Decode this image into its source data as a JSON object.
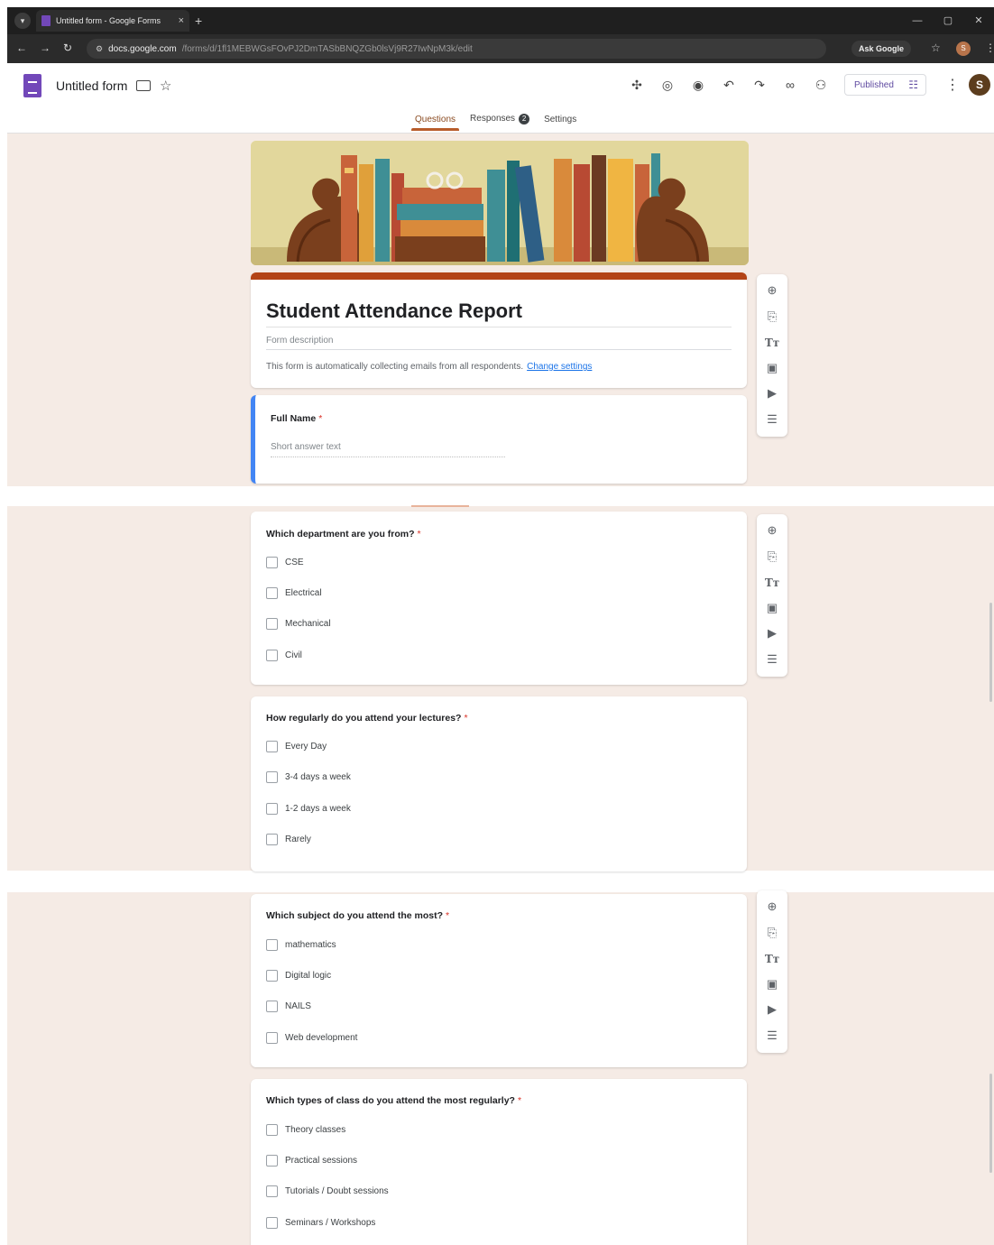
{
  "browser": {
    "tab_title": "Untitled form - Google Forms",
    "tab_close": "×",
    "new_tab": "+",
    "url_host": "docs.google.com",
    "url_path": "/forms/d/1fl1MEBWGsFOvPJ2DmTASbBNQZGb0lsVj9R27IwNpM3k/edit",
    "ask_google": "Ask Google",
    "profile_initial": "S",
    "window_buttons": [
      "—",
      "▢",
      "✕"
    ]
  },
  "header": {
    "doc_title": "Untitled form",
    "published_label": "Published",
    "avatar_initial": "S",
    "tabs": [
      {
        "label": "Questions"
      },
      {
        "label": "Responses",
        "badge": "2"
      },
      {
        "label": "Settings"
      }
    ]
  },
  "form": {
    "title": "Student Attendance Report",
    "description_placeholder": "Form description",
    "email_note": "This form is automatically collecting emails from all respondents.",
    "change_settings": "Change settings"
  },
  "required_mark": "*",
  "questions": [
    {
      "title": "Full Name",
      "placeholder": "Short answer text"
    },
    {
      "title": "Which department are you from?",
      "options": [
        "CSE",
        "Electrical",
        "Mechanical",
        "Civil"
      ]
    },
    {
      "title": "How regularly do you attend your lectures?",
      "options": [
        "Every Day",
        "3-4 days a week",
        "1-2 days a week",
        "Rarely"
      ]
    },
    {
      "title": "Which subject do you attend the most?",
      "options": [
        "mathematics",
        "Digital logic",
        "NAILS",
        "Web development"
      ]
    },
    {
      "title": "Which types of class do you attend the most regularly?",
      "options": [
        "Theory classes",
        "Practical sessions",
        "Tutorials / Doubt sessions",
        "Seminars / Workshops"
      ]
    }
  ],
  "toolbar_icons": [
    "add-question-icon",
    "import-questions-icon",
    "add-title-icon",
    "add-image-icon",
    "add-video-icon",
    "add-section-icon"
  ],
  "colors": {
    "theme_accent": "#b34316",
    "background": "#f5ebe5",
    "forms_purple": "#7248b9",
    "focus_blue": "#4285f4",
    "required_red": "#d93025"
  }
}
